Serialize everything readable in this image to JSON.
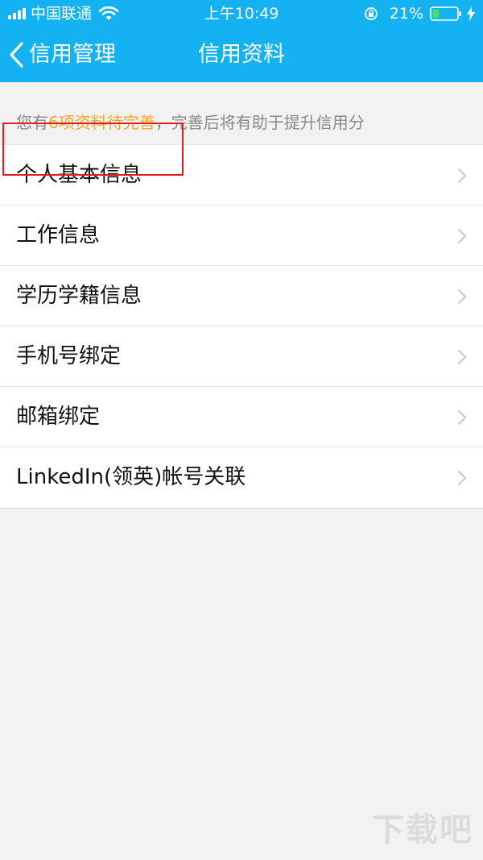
{
  "status_bar": {
    "carrier": "中国联通",
    "time": "上午10:49",
    "battery": "21%"
  },
  "nav": {
    "back_label": "信用管理",
    "title": "信用资料"
  },
  "notice": {
    "prefix": "您有",
    "highlight": "6项资料待完善",
    "suffix": "，完善后将有助于提升信用分",
    "highlight_color": "#f5a623"
  },
  "items": [
    {
      "label": "个人基本信息"
    },
    {
      "label": "工作信息"
    },
    {
      "label": "学历学籍信息"
    },
    {
      "label": "手机号绑定"
    },
    {
      "label": "邮箱绑定"
    },
    {
      "label": "LinkedIn(领英)帐号关联"
    }
  ],
  "watermark": "下载吧",
  "colors": {
    "header": "#14b2f0",
    "background": "#f2f2f2",
    "highlight_box": "#e02020"
  }
}
